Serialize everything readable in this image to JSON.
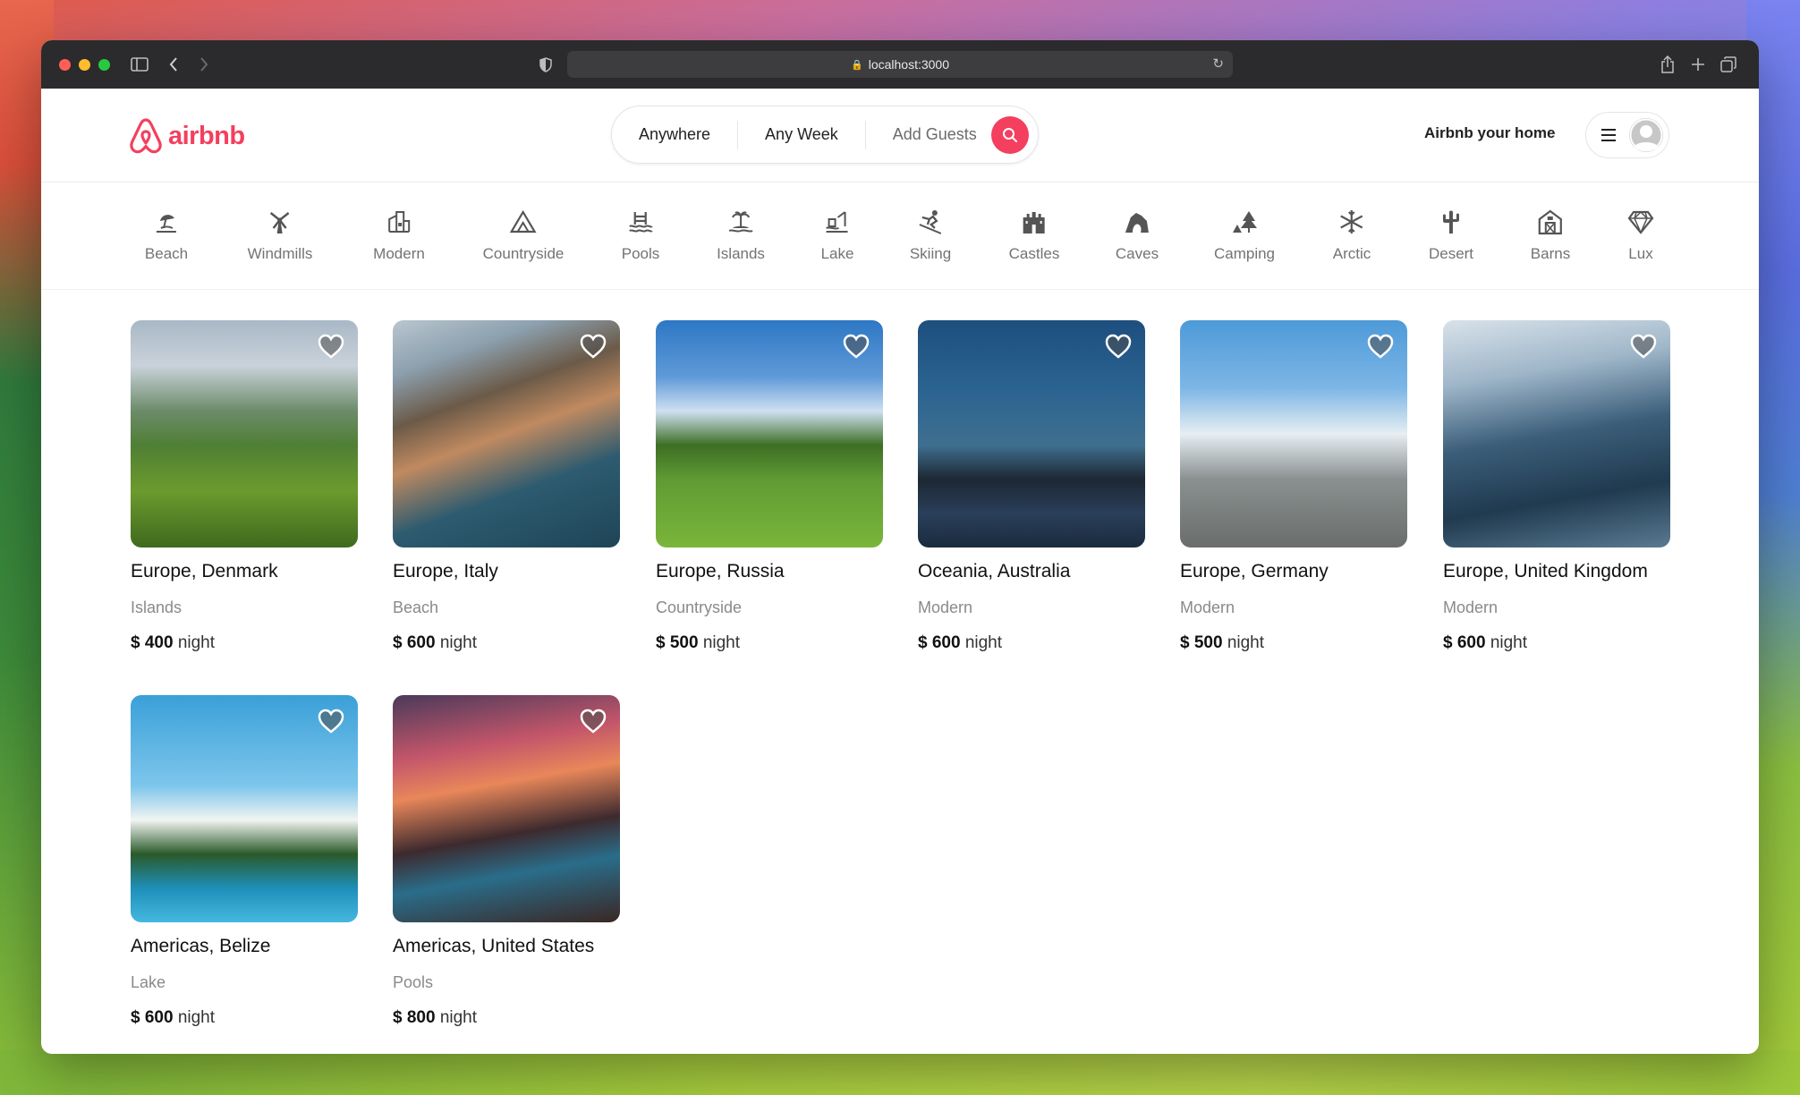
{
  "browser": {
    "url": "localhost:3000"
  },
  "navbar": {
    "logo_text": "airbnb",
    "search": {
      "location": "Anywhere",
      "week": "Any Week",
      "guests": "Add Guests"
    },
    "host_link": "Airbnb your home"
  },
  "categories": [
    {
      "label": "Beach",
      "icon": "beach-icon"
    },
    {
      "label": "Windmills",
      "icon": "windmill-icon"
    },
    {
      "label": "Modern",
      "icon": "modern-icon"
    },
    {
      "label": "Countryside",
      "icon": "countryside-icon"
    },
    {
      "label": "Pools",
      "icon": "pool-icon"
    },
    {
      "label": "Islands",
      "icon": "island-icon"
    },
    {
      "label": "Lake",
      "icon": "lake-icon"
    },
    {
      "label": "Skiing",
      "icon": "skiing-icon"
    },
    {
      "label": "Castles",
      "icon": "castle-icon"
    },
    {
      "label": "Caves",
      "icon": "cave-icon"
    },
    {
      "label": "Camping",
      "icon": "camping-icon"
    },
    {
      "label": "Arctic",
      "icon": "snowflake-icon"
    },
    {
      "label": "Desert",
      "icon": "cactus-icon"
    },
    {
      "label": "Barns",
      "icon": "barn-icon"
    },
    {
      "label": "Lux",
      "icon": "diamond-icon"
    }
  ],
  "listings": [
    {
      "location": "Europe, Denmark",
      "category": "Islands",
      "price": "$ 400",
      "unit": "night"
    },
    {
      "location": "Europe, Italy",
      "category": "Beach",
      "price": "$ 600",
      "unit": "night"
    },
    {
      "location": "Europe, Russia",
      "category": "Countryside",
      "price": "$ 500",
      "unit": "night"
    },
    {
      "location": "Oceania, Australia",
      "category": "Modern",
      "price": "$ 600",
      "unit": "night"
    },
    {
      "location": "Europe, Germany",
      "category": "Modern",
      "price": "$ 500",
      "unit": "night"
    },
    {
      "location": "Europe, United Kingdom",
      "category": "Modern",
      "price": "$ 600",
      "unit": "night"
    },
    {
      "location": "Americas, Belize",
      "category": "Lake",
      "price": "$ 600",
      "unit": "night"
    },
    {
      "location": "Americas, United States",
      "category": "Pools",
      "price": "$ 800",
      "unit": "night"
    }
  ],
  "colors": {
    "brand": "#f43f5e",
    "muted_text": "#737373"
  }
}
